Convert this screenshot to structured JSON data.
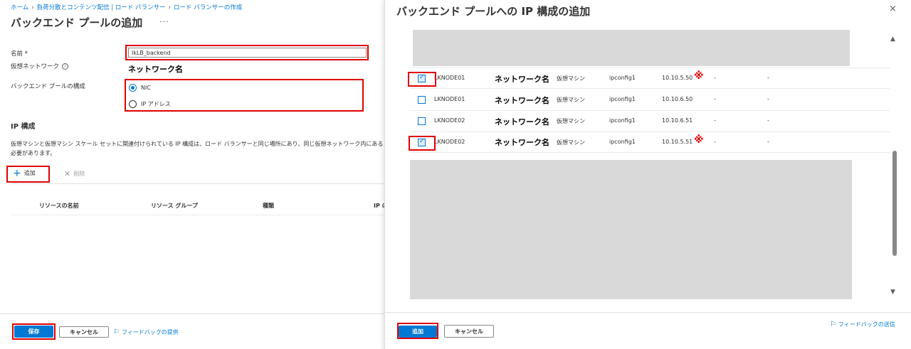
{
  "breadcrumb": [
    "ホーム",
    "負荷分散とコンテンツ配信 | ロード バランサー",
    "ロード バランサーの作成"
  ],
  "page": {
    "title": "バックエンド プールの追加",
    "more": "···"
  },
  "form": {
    "name_label": "名前 *",
    "name_value": "lkLB_backend",
    "vnet_label": "仮想ネットワーク",
    "vnet_value": "ネットワーク名",
    "pool_config_label": "バックエンド プールの構成",
    "options": [
      "NIC",
      "IP アドレス"
    ],
    "selected_option": "NIC"
  },
  "ip_config": {
    "title": "IP 構成",
    "description": "仮想マシンと仮想マシン スケール セットに関連付けられている IP 構成は、ロード バランサーと同じ場所にあり、同じ仮想ネットワーク内にある必要があります。",
    "add_label": "追加",
    "delete_label": "削除",
    "columns": [
      "リソースの名前",
      "リソース グループ",
      "種類",
      "IP の"
    ]
  },
  "footer": {
    "save_label": "保存",
    "cancel_label": "キャンセル",
    "feedback_label": "フィードバックの提供"
  },
  "panel": {
    "title": "バックエンド プールへの IP 構成の追加",
    "close": "×",
    "rows": [
      {
        "checked": true,
        "name": "LKNODE01",
        "network": "ネットワーク名",
        "type": "仮想マシン",
        "ipconfig": "ipconfig1",
        "ip": "10.10.5.50",
        "marked": true,
        "col7": "-",
        "col8": "-"
      },
      {
        "checked": false,
        "name": "LKNODE01",
        "network": "ネットワーク名",
        "type": "仮想マシン",
        "ipconfig": "ipconfig1",
        "ip": "10.10.6.50",
        "marked": false,
        "col7": "-",
        "col8": "-"
      },
      {
        "checked": false,
        "name": "LKNODE02",
        "network": "ネットワーク名",
        "type": "仮想マシン",
        "ipconfig": "ipconfig1",
        "ip": "10.10.6.51",
        "marked": false,
        "col7": "-",
        "col8": "-"
      },
      {
        "checked": true,
        "name": "LKNODE02",
        "network": "ネットワーク名",
        "type": "仮想マシン",
        "ipconfig": "ipconfig1",
        "ip": "10.10.5.51",
        "marked": true,
        "col7": "-",
        "col8": "-"
      }
    ],
    "mark_symbol": "※",
    "add_label": "追加",
    "cancel_label": "キャンセル",
    "feedback_label": "フィードバックの送信"
  },
  "colors": {
    "accent": "#0078d4",
    "highlight": "#e00000",
    "redacted": "#d9d9d9"
  }
}
